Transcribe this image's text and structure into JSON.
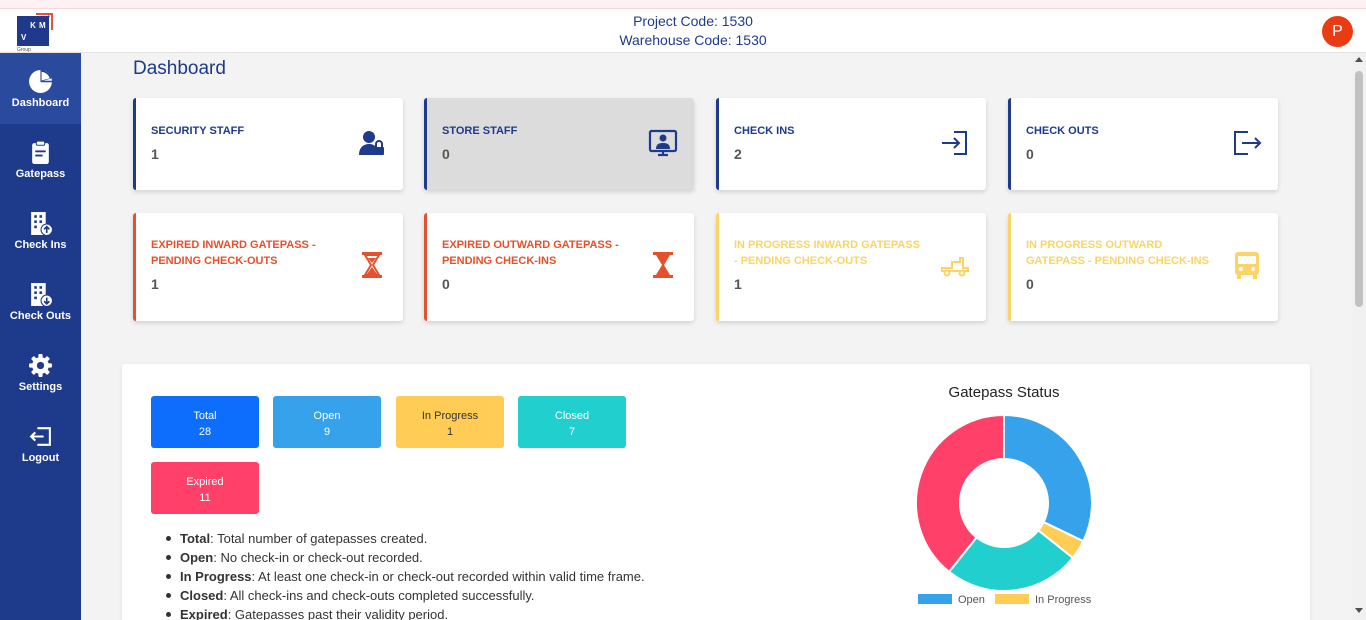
{
  "header": {
    "logo_text": [
      "K",
      "M",
      "V"
    ],
    "logo_sub": "Group",
    "project_code": "Project Code: 1530",
    "warehouse_code": "Warehouse Code: 1530",
    "avatar_initial": "P"
  },
  "sidebar": {
    "items": [
      {
        "label": "Dashboard",
        "icon": "pie-chart-icon",
        "active": true
      },
      {
        "label": "Gatepass",
        "icon": "clipboard-icon"
      },
      {
        "label": "Check Ins",
        "icon": "building-upload-icon"
      },
      {
        "label": "Check Outs",
        "icon": "building-download-icon"
      },
      {
        "label": "Settings",
        "icon": "gear-icon"
      },
      {
        "label": "Logout",
        "icon": "logout-icon"
      }
    ]
  },
  "page": {
    "title": "Dashboard"
  },
  "stats": [
    {
      "title": "SECURITY STAFF",
      "value": "1",
      "icon": "user-lock-icon",
      "color": "#1e3a8a"
    },
    {
      "title": "STORE STAFF",
      "value": "0",
      "icon": "user-screen-icon",
      "color": "#1e3a8a"
    },
    {
      "title": "CHECK INS",
      "value": "2",
      "icon": "sign-in-icon",
      "color": "#1e3a8a"
    },
    {
      "title": "CHECK OUTS",
      "value": "0",
      "icon": "sign-out-icon",
      "color": "#1e3a8a"
    },
    {
      "title": "EXPIRED INWARD GATEPASS - PENDING CHECK-OUTS",
      "value": "1",
      "icon": "hourglass-end-icon",
      "color": "#e4512c"
    },
    {
      "title": "EXPIRED OUTWARD GATEPASS - PENDING CHECK-INS",
      "value": "0",
      "icon": "hourglass-start-icon",
      "color": "#e4512c"
    },
    {
      "title": "IN PROGRESS INWARD GATEPASS - PENDING CHECK-OUTS",
      "value": "1",
      "icon": "truck-icon",
      "color": "#fbd367"
    },
    {
      "title": "IN PROGRESS OUTWARD GATEPASS - PENDING CHECK-INS",
      "value": "0",
      "icon": "bus-icon",
      "color": "#fbd367"
    }
  ],
  "summary": [
    {
      "label": "Total",
      "value": "28",
      "color": "#0d6efd"
    },
    {
      "label": "Open",
      "value": "9",
      "color": "#36a2eb"
    },
    {
      "label": "In Progress",
      "value": "1",
      "color": "#ffcd56"
    },
    {
      "label": "Closed",
      "value": "7",
      "color": "#22cfcf"
    },
    {
      "label": "Expired",
      "value": "11",
      "color": "#ff4069"
    }
  ],
  "definitions": [
    {
      "term": "Total",
      "text": ": Total number of gatepasses created."
    },
    {
      "term": "Open",
      "text": ": No check-in or check-out recorded."
    },
    {
      "term": "In Progress",
      "text": ": At least one check-in or check-out recorded within valid time frame."
    },
    {
      "term": "Closed",
      "text": ": All check-ins and check-outs completed successfully."
    },
    {
      "term": "Expired",
      "text": ": Gatepasses past their validity period."
    }
  ],
  "chart_data": {
    "type": "pie",
    "title": "Gatepass Status",
    "categories": [
      "Open",
      "In Progress",
      "Closed",
      "Expired"
    ],
    "values": [
      9,
      1,
      7,
      11
    ],
    "colors": [
      "#36a2eb",
      "#ffcd56",
      "#22cfcf",
      "#ff4069"
    ],
    "legend_visible": [
      "Open",
      "In Progress"
    ],
    "legend": "bottom"
  }
}
